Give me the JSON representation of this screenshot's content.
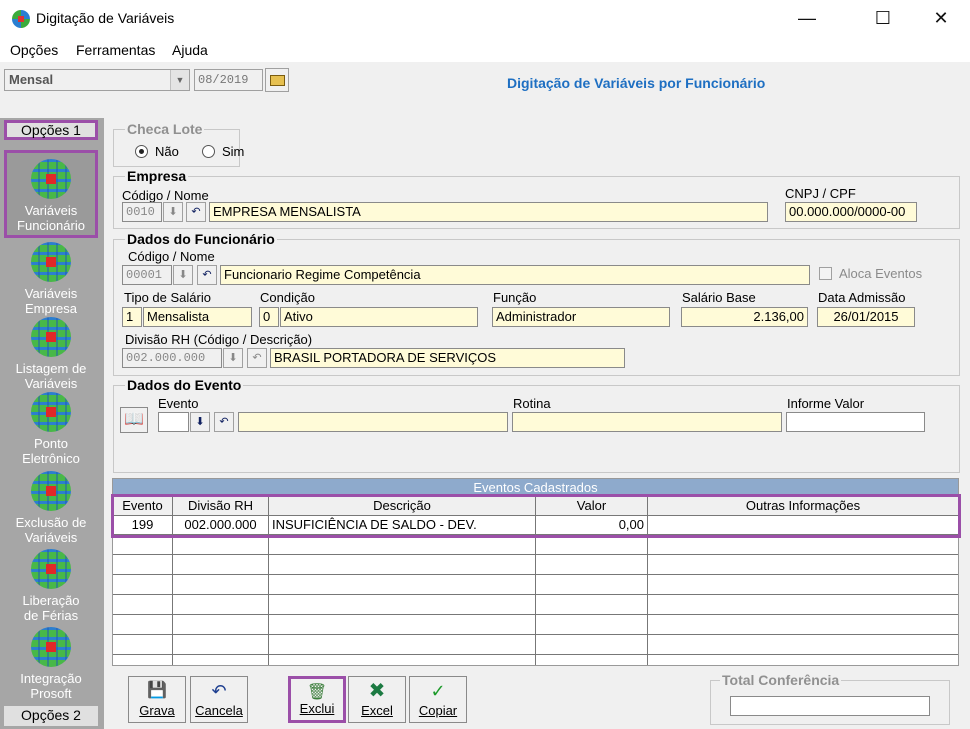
{
  "window": {
    "title": "Digitação de Variáveis",
    "minimize": "—",
    "maximize": "☐",
    "close": "✕"
  },
  "menu": [
    "Opções",
    "Ferramentas",
    "Ajuda"
  ],
  "toolbar": {
    "period": "Mensal",
    "date": "08/2019",
    "header_title": "Digitação de Variáveis por Funcionário"
  },
  "sidebar": {
    "tab_top": "Opções 1",
    "tab_bottom": "Opções 2",
    "items": [
      {
        "line1": "Variáveis",
        "line2": "Funcionário"
      },
      {
        "line1": "Variáveis",
        "line2": "Empresa"
      },
      {
        "line1": "Listagem de",
        "line2": "Variáveis"
      },
      {
        "line1": "Ponto",
        "line2": "Eletrônico"
      },
      {
        "line1": "Exclusão de",
        "line2": "Variáveis"
      },
      {
        "line1": "Liberação",
        "line2": "de Férias"
      },
      {
        "line1": "Integração",
        "line2": "Prosoft"
      }
    ]
  },
  "checa_lote": {
    "title": "Checa Lote",
    "opt_nao": "Não",
    "opt_sim": "Sim"
  },
  "empresa": {
    "title": "Empresa",
    "codigo_label": "Código / Nome",
    "codigo": "0010",
    "nome": "EMPRESA MENSALISTA",
    "cnpj_label": "CNPJ / CPF",
    "cnpj": "00.000.000/0000-00"
  },
  "funcionario": {
    "title": "Dados do Funcionário",
    "codigo_label": "Código / Nome",
    "codigo": "00001",
    "nome": "Funcionario Regime Competência",
    "aloca_label": "Aloca Eventos",
    "tipo_label": "Tipo de Salário",
    "tipo_code": "1",
    "tipo": "Mensalista",
    "condicao_label": "Condição",
    "condicao_code": "0",
    "condicao": "Ativo",
    "funcao_label": "Função",
    "funcao": "Administrador",
    "salario_label": "Salário Base",
    "salario": "2.136,00",
    "admissao_label": "Data Admissão",
    "admissao": "26/01/2015",
    "divisao_label": "Divisão RH (Código / Descrição)",
    "divisao_code": "002.000.000",
    "divisao": "BRASIL PORTADORA DE SERVIÇOS"
  },
  "evento": {
    "title": "Dados do Evento",
    "evento_label": "Evento",
    "rotina_label": "Rotina",
    "valor_label": "Informe Valor"
  },
  "grid": {
    "caption": "Eventos Cadastrados",
    "columns": [
      "Evento",
      "Divisão RH",
      "Descrição",
      "Valor",
      "Outras Informações"
    ],
    "rows": [
      {
        "evento": "199",
        "divisao": "002.000.000",
        "descricao": "INSUFICIÊNCIA DE SALDO - DEV.",
        "valor": "0,00",
        "outras": ""
      }
    ]
  },
  "buttons": {
    "grava": "Grava",
    "cancela": "Cancela",
    "exclui": "Exclui",
    "excel": "Excel",
    "copiar": "Copiar"
  },
  "total": {
    "title": "Total Conferência"
  }
}
